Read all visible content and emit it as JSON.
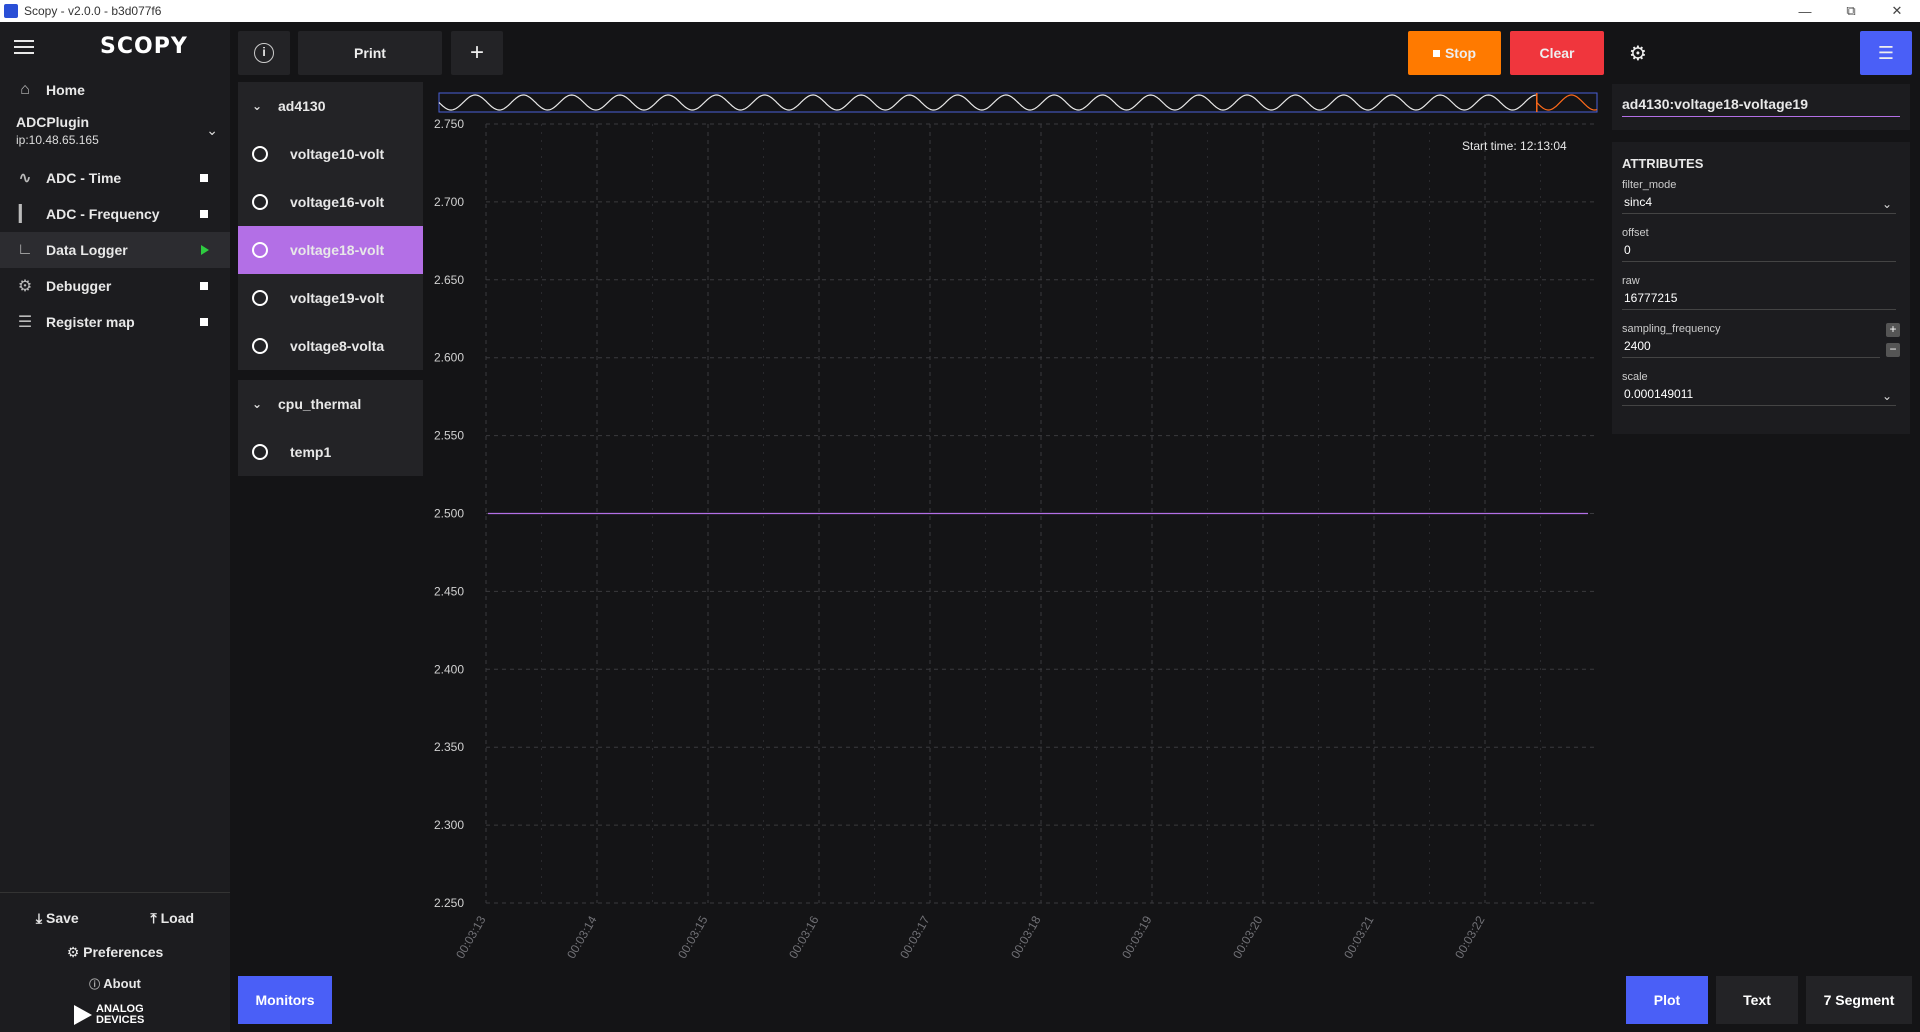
{
  "window": {
    "title": "Scopy - v2.0.0 - b3d077f6"
  },
  "sidebar": {
    "logo": "SCOPY",
    "home_label": "Home",
    "device": {
      "name": "ADCPlugin",
      "ip": "ip:10.48.65.165"
    },
    "items": [
      {
        "label": "ADC - Time",
        "status": "stopped"
      },
      {
        "label": "ADC - Frequency",
        "status": "stopped"
      },
      {
        "label": "Data Logger",
        "status": "running"
      },
      {
        "label": "Debugger",
        "status": "stopped"
      },
      {
        "label": "Register map",
        "status": "stopped"
      }
    ],
    "save_label": "Save",
    "load_label": "Load",
    "preferences_label": "Preferences",
    "about_label": "About",
    "brand": {
      "line1": "ANALOG",
      "line2": "DEVICES"
    }
  },
  "toolbar": {
    "print_label": "Print",
    "add_label": "+",
    "stop_label": "Stop",
    "clear_label": "Clear"
  },
  "channels": {
    "groups": [
      {
        "name": "ad4130",
        "items": [
          "voltage10-volt",
          "voltage16-volt",
          "voltage18-volt",
          "voltage19-volt",
          "voltage8-volta"
        ]
      },
      {
        "name": "cpu_thermal",
        "items": [
          "temp1"
        ]
      }
    ],
    "active": "voltage18-volt"
  },
  "plot": {
    "start_time_label": "Start time:",
    "start_time": "12:13:04"
  },
  "chart_data": {
    "type": "line",
    "title": "",
    "xlabel": "",
    "ylabel": "",
    "ylim": [
      2.25,
      2.75
    ],
    "yticks": [
      "2.750",
      "2.700",
      "2.650",
      "2.600",
      "2.550",
      "2.500",
      "2.450",
      "2.400",
      "2.350",
      "2.300",
      "2.250"
    ],
    "xticks": [
      "00:03:13",
      "00:03:14",
      "00:03:15",
      "00:03:16",
      "00:03:17",
      "00:03:18",
      "00:03:19",
      "00:03:20",
      "00:03:21",
      "00:03:22"
    ],
    "grid": true,
    "series": [
      {
        "color": "#b36fe6",
        "x": [
          "00:03:13",
          "00:03:23"
        ],
        "y": [
          2.5,
          2.5
        ]
      }
    ],
    "overview": {
      "waveform": "sine",
      "cycles": 24,
      "trace_color": "#e8e8e8",
      "marker_color": "#ff6a1a",
      "border_color": "#4a5fd8"
    }
  },
  "right_panel": {
    "channel_title": "ad4130:voltage18-voltage19",
    "attributes_header": "ATTRIBUTES",
    "attributes": [
      {
        "name": "filter_mode",
        "value": "sinc4",
        "control": "dropdown"
      },
      {
        "name": "offset",
        "value": "0",
        "control": "text"
      },
      {
        "name": "raw",
        "value": "16777215",
        "control": "text"
      },
      {
        "name": "sampling_frequency",
        "value": "2400",
        "control": "spinbox"
      },
      {
        "name": "scale",
        "value": "0.000149011",
        "control": "dropdown"
      }
    ]
  },
  "bottom": {
    "monitors_label": "Monitors",
    "plot_label": "Plot",
    "text_label": "Text",
    "segment_label": "7 Segment"
  },
  "colors": {
    "accent": "#4a5ff7",
    "stop": "#ff7a00",
    "clear": "#f0363d",
    "channel": "#b36fe6",
    "running": "#2ecc40"
  }
}
